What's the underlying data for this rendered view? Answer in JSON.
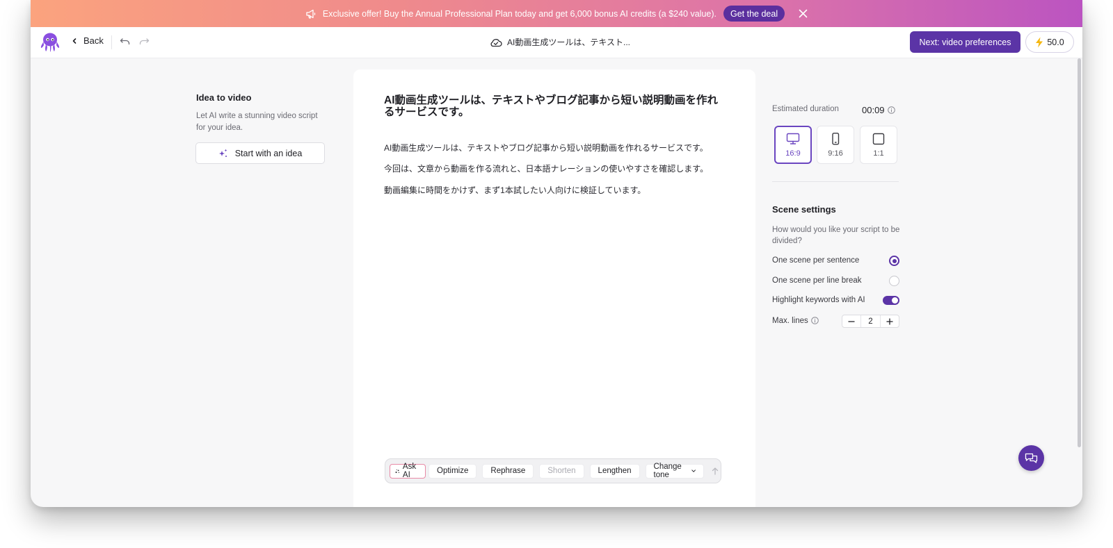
{
  "banner": {
    "text": "Exclusive offer! Buy the Annual Professional Plan today and get 6,000 bonus AI credits (a $240 value).",
    "cta_label": "Get the deal",
    "gradient_colors": [
      "#fba37e",
      "#bb54c1"
    ]
  },
  "toolbar": {
    "back_label": "Back",
    "doc_title": "AI動画生成ツールは、テキスト...",
    "next_label": "Next: video preferences",
    "credits": "50.0",
    "accent_color": "#5b34a6"
  },
  "left_panel": {
    "title": "Idea to video",
    "description": "Let AI write a stunning video script for your idea.",
    "button_label": "Start with an idea"
  },
  "editor": {
    "heading": "AI動画生成ツールは、テキストやブログ記事から短い説明動画を作れるサービスです。",
    "paragraphs": [
      "AI動画生成ツールは、テキストやブログ記事から短い説明動画を作れるサービスです。",
      "今回は、文章から動画を作る流れと、日本語ナレーションの使いやすさを確認します。",
      "動画編集に時間をかけず、まず1本試したい人向けに検証しています。"
    ],
    "ai_bar": {
      "ask_ai": "Ask AI",
      "optimize": "Optimize",
      "rephrase": "Rephrase",
      "shorten": "Shorten",
      "lengthen": "Lengthen",
      "change_tone": "Change tone"
    }
  },
  "right_panel": {
    "estimated_label": "Estimated duration",
    "estimated_value": "00:09",
    "ratios": [
      {
        "label": "16:9",
        "selected": true
      },
      {
        "label": "9:16",
        "selected": false
      },
      {
        "label": "1:1",
        "selected": false
      }
    ],
    "scene_title": "Scene settings",
    "scene_desc": "How would you like your script to be divided?",
    "option_sentence": "One scene per sentence",
    "option_linebreak": "One scene per line break",
    "highlight_label": "Highlight keywords with AI",
    "highlight_on": true,
    "max_lines_label": "Max. lines",
    "max_lines_value": "2"
  },
  "icons": [
    "megaphone-icon",
    "close-icon",
    "octopus-logo-icon",
    "chevron-left-icon",
    "undo-icon",
    "redo-icon",
    "cloud-icon",
    "bolt-icon",
    "sparkle-icon",
    "monitor-icon",
    "phone-icon",
    "square-icon",
    "info-icon",
    "minus-icon",
    "plus-icon",
    "arrow-up-icon",
    "chat-icon"
  ]
}
